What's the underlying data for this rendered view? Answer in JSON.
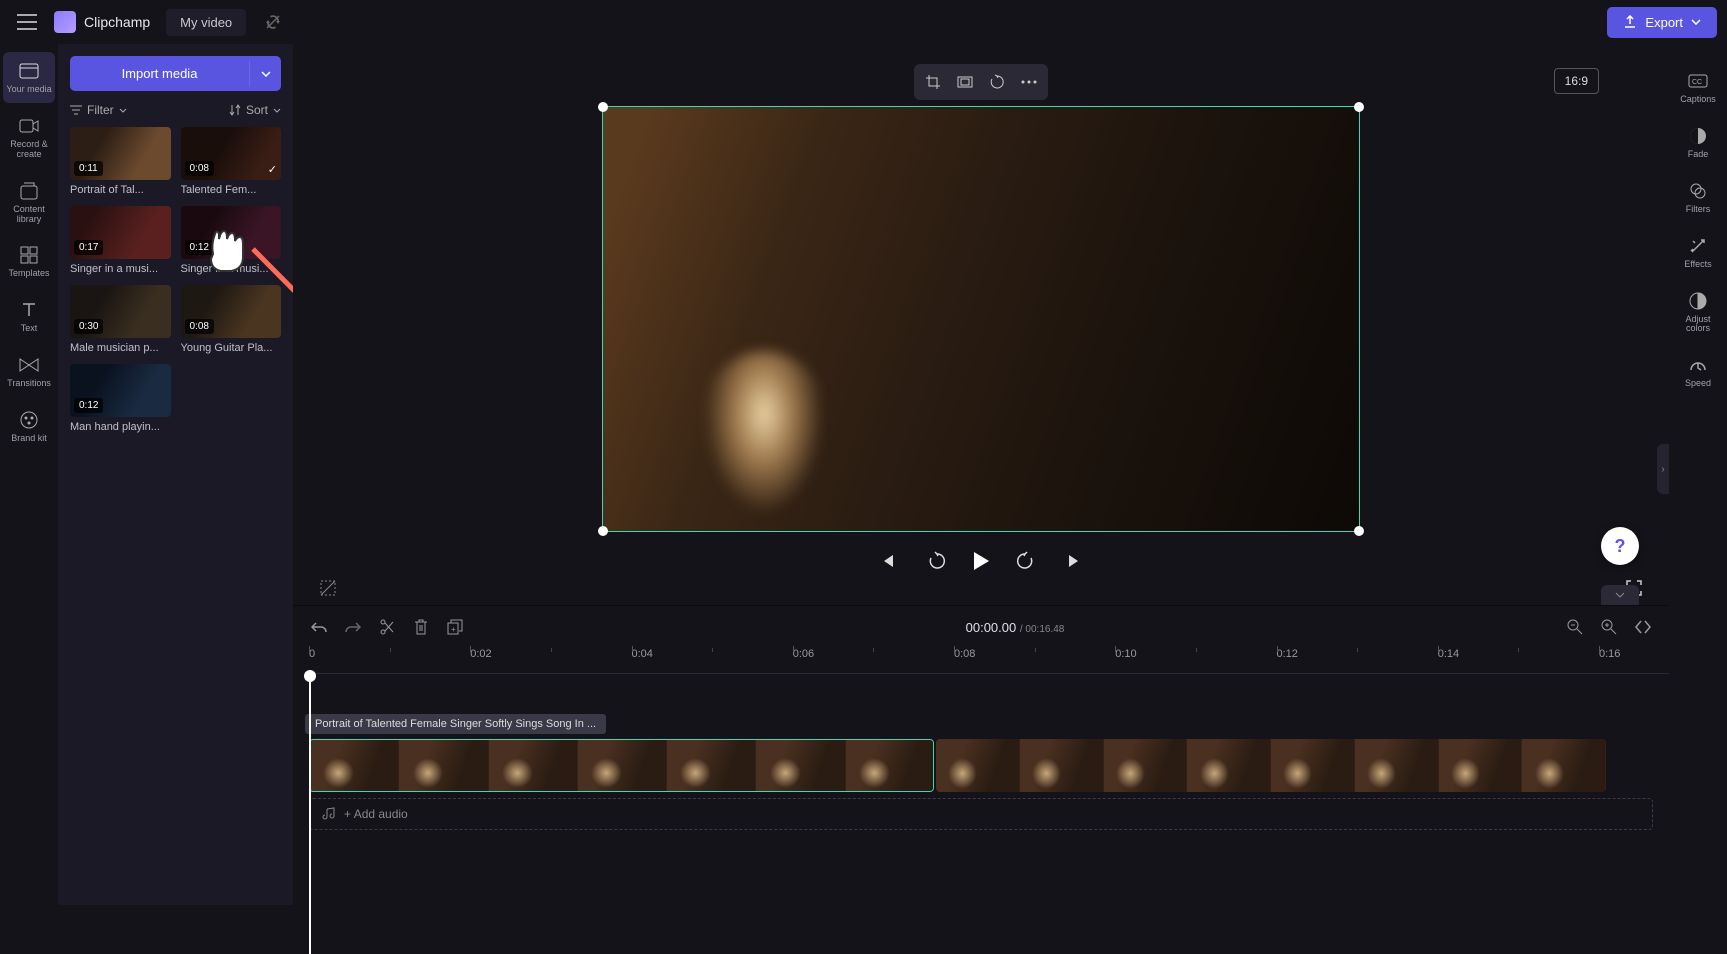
{
  "app": {
    "name": "Clipchamp",
    "project": "My video"
  },
  "export": {
    "label": "Export"
  },
  "leftRail": [
    {
      "icon": "media",
      "label": "Your media"
    },
    {
      "icon": "record",
      "label": "Record & create"
    },
    {
      "icon": "library",
      "label": "Content library"
    },
    {
      "icon": "templates",
      "label": "Templates"
    },
    {
      "icon": "text",
      "label": "Text"
    },
    {
      "icon": "transitions",
      "label": "Transitions"
    },
    {
      "icon": "brand",
      "label": "Brand kit"
    }
  ],
  "mediaPanel": {
    "import": "Import media",
    "filter": "Filter",
    "sort": "Sort",
    "items": [
      {
        "dur": "0:11",
        "title": "Portrait of Tal...",
        "cls": "singer1"
      },
      {
        "dur": "0:08",
        "title": "Talented Fem...",
        "cls": "singer2",
        "used": true
      },
      {
        "dur": "0:17",
        "title": "Singer in a musi...",
        "cls": "music1"
      },
      {
        "dur": "0:12",
        "title": "Singer in a musi...",
        "cls": "music2"
      },
      {
        "dur": "0:30",
        "title": "Male musician p...",
        "cls": "guitar1"
      },
      {
        "dur": "0:08",
        "title": "Young Guitar Pla...",
        "cls": "guitar2"
      },
      {
        "dur": "0:12",
        "title": "Man hand playin...",
        "cls": "bass"
      }
    ]
  },
  "preview": {
    "aspect": "16:9"
  },
  "rightRail": [
    {
      "icon": "captions",
      "label": "Captions"
    },
    {
      "icon": "fade",
      "label": "Fade"
    },
    {
      "icon": "filters",
      "label": "Filters"
    },
    {
      "icon": "effects",
      "label": "Effects"
    },
    {
      "icon": "colors",
      "label": "Adjust colors"
    },
    {
      "icon": "speed",
      "label": "Speed"
    }
  ],
  "timeline": {
    "current": "00:00.00",
    "total": "00:16.48",
    "ticks": [
      "0",
      "0:02",
      "0:04",
      "0:06",
      "0:08",
      "0:10",
      "0:12",
      "0:14",
      "0:16"
    ],
    "clipTooltip": "Portrait of Talented Female Singer Softly Sings Song In ...",
    "addAudio": "Add audio",
    "clip1Thumbs": 7,
    "clip2Thumbs": 8
  }
}
